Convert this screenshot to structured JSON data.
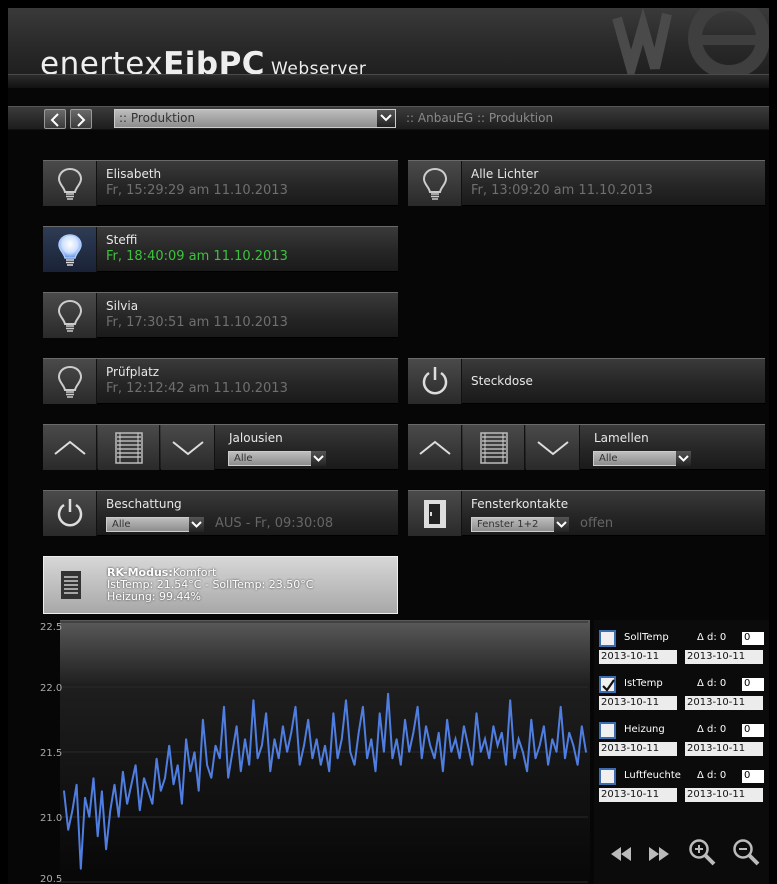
{
  "header": {
    "brand": "enertex",
    "product": "EibPC",
    "suffix": "Webserver"
  },
  "nav": {
    "back_icon": "chevron-left",
    "forward_icon": "chevron-right",
    "page_select": ":: Produktion",
    "breadcrumb": ":: AnbauEG :: Produktion"
  },
  "tiles": {
    "elisabeth": {
      "title": "Elisabeth",
      "status": "Fr, 15:29:29 am 11.10.2013",
      "icon": "light-bulb-off"
    },
    "alle_lichter": {
      "title": "Alle Lichter",
      "status": "Fr, 13:09:20 am 11.10.2013",
      "icon": "light-bulb-off"
    },
    "steffi": {
      "title": "Steffi",
      "status": "Fr, 18:40:09 am 11.10.2013",
      "icon": "light-bulb-on"
    },
    "silvia": {
      "title": "Silvia",
      "status": "Fr, 17:30:51 am 11.10.2013",
      "icon": "light-bulb-off"
    },
    "pruefplatz": {
      "title": "Prüfplatz",
      "status": "Fr, 12:12:42 am 11.10.2013",
      "icon": "light-bulb-off"
    },
    "steckdose": {
      "title": "Steckdose",
      "icon": "power-icon"
    },
    "jalousien": {
      "title": "Jalousien",
      "select": "Alle"
    },
    "lamellen": {
      "title": "Lamellen",
      "select": "Alle"
    },
    "beschattung": {
      "title": "Beschattung",
      "select": "Alle",
      "status": "AUS - Fr, 09:30:08"
    },
    "fensterkontakte": {
      "title": "Fensterkontakte",
      "select": "Fenster 1+2",
      "status": "offen"
    }
  },
  "rk": {
    "mode_label": "RK-Modus:",
    "mode_value": "Komfort",
    "line2": "IstTemp: 21.54°C - SollTemp: 23.50°C",
    "line3": "Heizung: 99.44%"
  },
  "legend": [
    {
      "name": "SollTemp",
      "checked": false,
      "delta": "Δ d: 0",
      "value": "0",
      "from": "2013-10-11",
      "to": "2013-10-11"
    },
    {
      "name": "IstTemp",
      "checked": true,
      "delta": "Δ d: 0",
      "value": "0",
      "from": "2013-10-11",
      "to": "2013-10-11"
    },
    {
      "name": "Heizung",
      "checked": false,
      "delta": "Δ d: 0",
      "value": "0",
      "from": "2013-10-11",
      "to": "2013-10-11"
    },
    {
      "name": "Luftfeuchte",
      "checked": false,
      "delta": "Δ d: 0",
      "value": "0",
      "from": "2013-10-11",
      "to": "2013-10-11"
    }
  ],
  "chart_controls": [
    "rewind-icon",
    "fast-forward-icon",
    "zoom-in-icon",
    "zoom-out-icon"
  ],
  "colors": {
    "series": "#4f7ee0",
    "active_status": "#3cc33c",
    "checkbox_border": "#3d6db0"
  },
  "chart_data": {
    "type": "line",
    "ylim": [
      20.5,
      22.5
    ],
    "yticks": [
      "22.5",
      "22.0",
      "21.5",
      "21.0",
      "20.5"
    ],
    "series": [
      {
        "name": "IstTemp",
        "values": [
          21.2,
          20.9,
          21.05,
          21.25,
          20.6,
          21.15,
          21.0,
          21.3,
          20.85,
          21.2,
          20.75,
          21.05,
          21.25,
          21.0,
          21.35,
          21.1,
          21.25,
          21.4,
          21.05,
          21.3,
          21.2,
          21.1,
          21.45,
          21.2,
          21.3,
          21.55,
          21.25,
          21.4,
          21.1,
          21.6,
          21.35,
          21.5,
          21.2,
          21.75,
          21.4,
          21.3,
          21.55,
          21.45,
          21.85,
          21.3,
          21.5,
          21.7,
          21.35,
          21.6,
          21.4,
          21.9,
          21.45,
          21.55,
          21.8,
          21.35,
          21.6,
          21.45,
          21.7,
          21.5,
          21.65,
          21.85,
          21.4,
          21.55,
          21.75,
          21.45,
          21.6,
          21.4,
          21.55,
          21.35,
          21.8,
          21.45,
          21.6,
          21.9,
          21.5,
          21.4,
          21.65,
          21.85,
          21.45,
          21.6,
          21.35,
          21.8,
          21.5,
          21.95,
          21.45,
          21.6,
          21.4,
          21.75,
          21.5,
          21.65,
          21.85,
          21.45,
          21.7,
          21.55,
          21.45,
          21.65,
          21.35,
          21.75,
          21.5,
          21.6,
          21.45,
          21.7,
          21.55,
          21.4,
          21.8,
          21.5,
          21.6,
          21.45,
          21.7,
          21.55,
          21.65,
          21.4,
          21.9,
          21.45,
          21.6,
          21.5,
          21.35,
          21.75,
          21.45,
          21.55,
          21.7,
          21.4,
          21.6,
          21.5,
          21.85,
          21.45,
          21.65,
          21.55,
          21.4,
          21.7,
          21.5
        ]
      }
    ]
  }
}
